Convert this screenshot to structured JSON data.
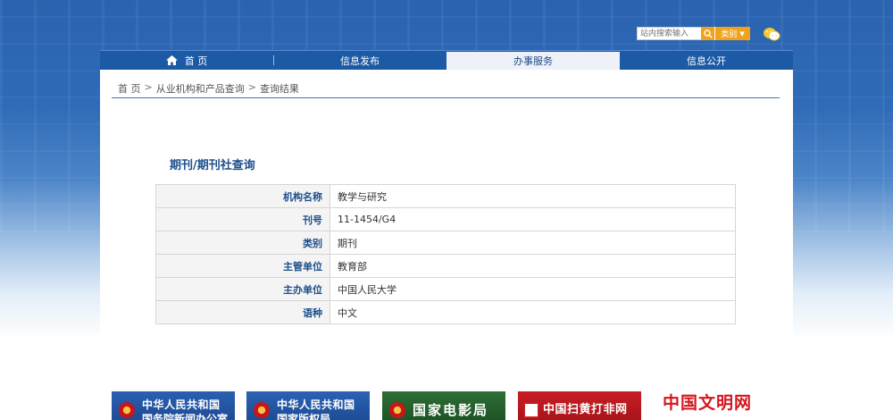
{
  "search": {
    "placeholder": "站内搜索输入",
    "category_label": "类别"
  },
  "nav": {
    "items": [
      {
        "label": "首 页"
      },
      {
        "label": "信息发布"
      },
      {
        "label": "办事服务"
      },
      {
        "label": "信息公开"
      }
    ]
  },
  "breadcrumb": {
    "home": "首 页",
    "sep": ">",
    "level2": "从业机构和产品查询",
    "level3": "查询结果"
  },
  "page": {
    "title": "期刊/期刊社查询"
  },
  "info_table": [
    {
      "key": "机构名称",
      "value": "教学与研究"
    },
    {
      "key": "刊号",
      "value": "11-1454/G4"
    },
    {
      "key": "类别",
      "value": "期刊"
    },
    {
      "key": "主管单位",
      "value": "教育部"
    },
    {
      "key": "主办单位",
      "value": "中国人民大学"
    },
    {
      "key": "语种",
      "value": "中文"
    }
  ],
  "banners": {
    "b1_line1": "中华人民共和国",
    "b1_line2": "国务院新闻办公室",
    "b2_line1": "中华人民共和国",
    "b2_line2": "国家版权局",
    "b3": "国家电影局",
    "b4": "中国扫黄打非网",
    "b5": "中国文明网"
  },
  "colors": {
    "nav_bg": "#1d5aa5",
    "accent": "#f0a21d",
    "title": "#1d4e8c"
  }
}
